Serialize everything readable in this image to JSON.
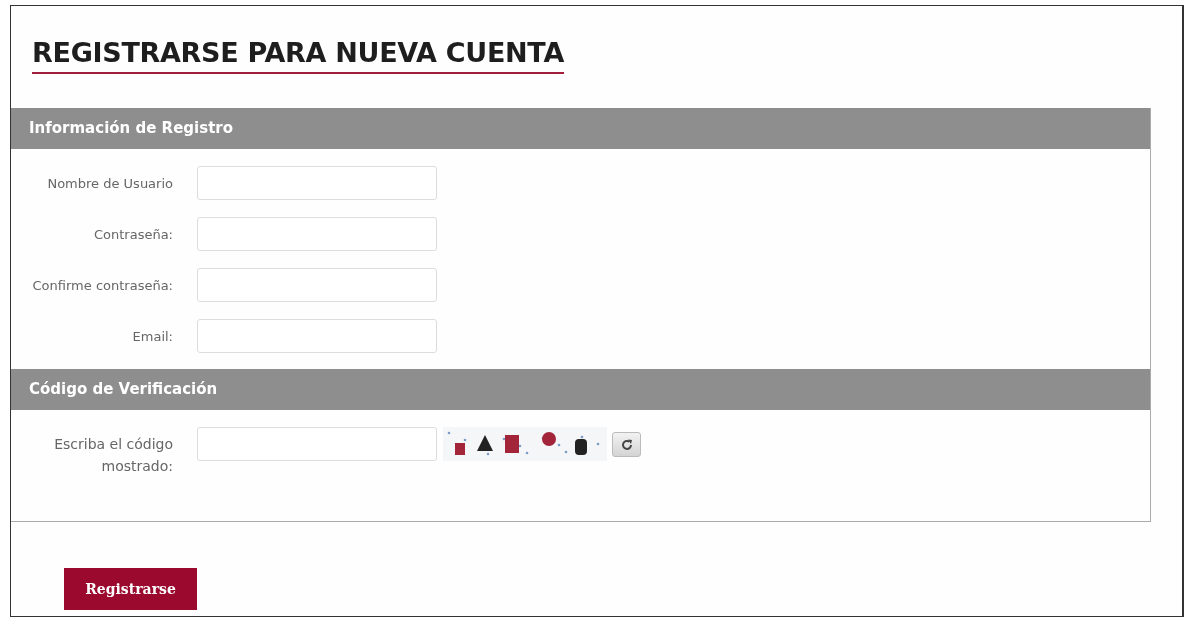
{
  "title": "REGISTRARSE PARA NUEVA CUENTA",
  "sections": [
    {
      "heading": "Información de Registro",
      "fields": [
        {
          "kind": "text",
          "label": "Nombre de Usuario"
        },
        {
          "kind": "text",
          "label": "Contraseña:"
        },
        {
          "kind": "text",
          "label": "Confirme contraseña:"
        },
        {
          "kind": "text",
          "label": "Email:"
        }
      ]
    },
    {
      "heading": "Código de Verificación",
      "fields": [
        {
          "kind": "captcha",
          "label": "Escriba el código mostrado:"
        }
      ]
    }
  ],
  "submit_button": "Registrarse"
}
